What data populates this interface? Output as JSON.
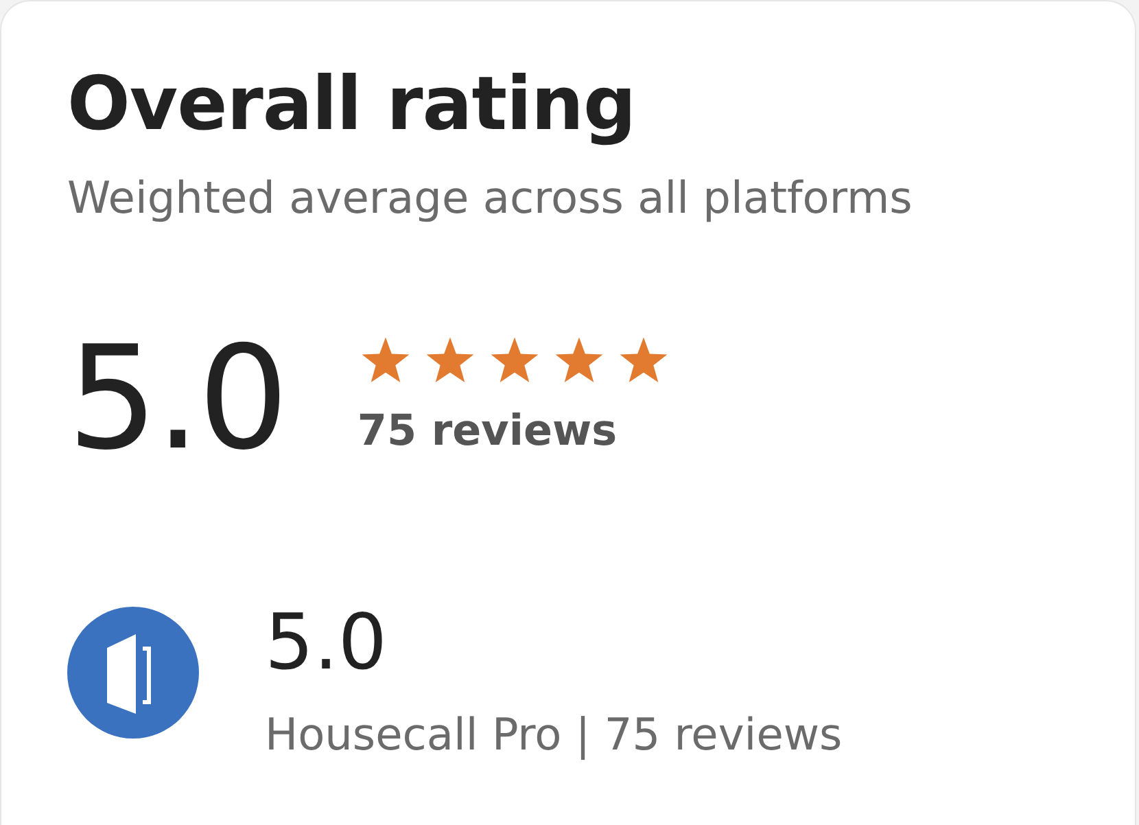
{
  "title": "Overall rating",
  "subtitle": "Weighted average across all platforms",
  "overall": {
    "score": "5.0",
    "stars": 5,
    "reviews": "75 reviews"
  },
  "platforms": [
    {
      "score": "5.0",
      "detail": "Housecall Pro | 75 reviews"
    }
  ]
}
